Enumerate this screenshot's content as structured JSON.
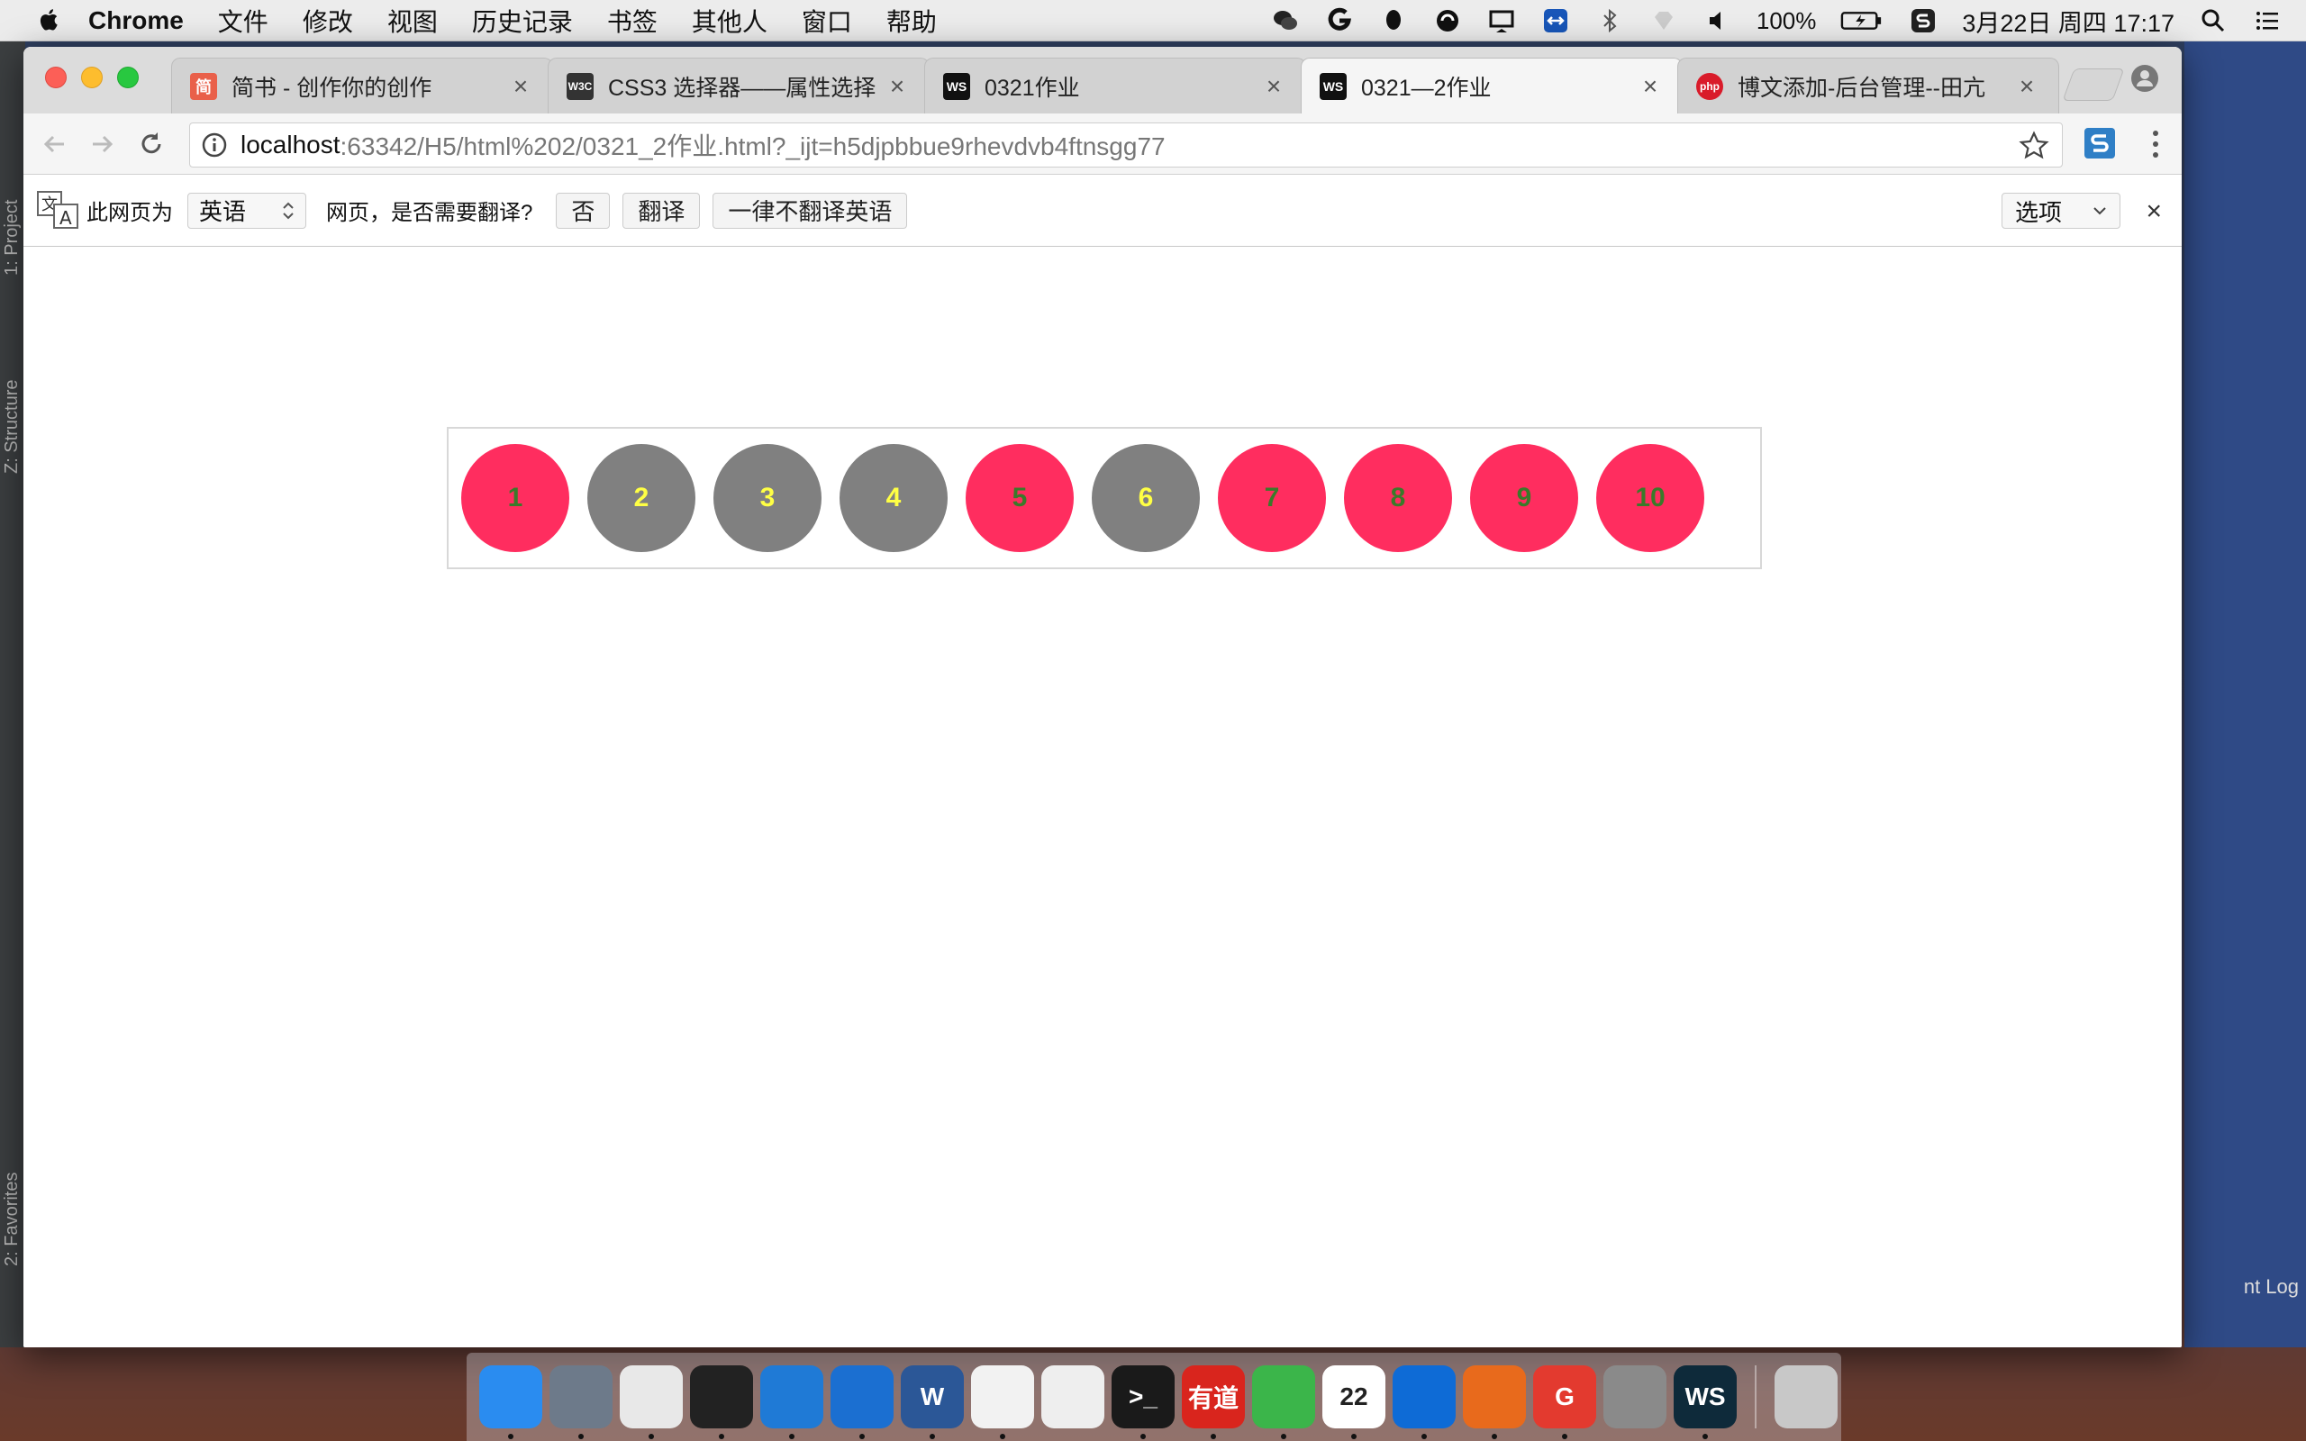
{
  "menubar": {
    "app_name": "Chrome",
    "menus": [
      "文件",
      "修改",
      "视图",
      "历史记录",
      "书签",
      "其他人",
      "窗口",
      "帮助"
    ],
    "battery": "100%",
    "datetime": "3月22日 周四  17:17"
  },
  "tabs": [
    {
      "title": "简书 - 创作你的创作",
      "favicon_text": "简",
      "favicon_color": "#e9604a"
    },
    {
      "title": "CSS3 选择器——属性选择器",
      "favicon_text": "W3C",
      "favicon_color": "#333333"
    },
    {
      "title": "0321作业",
      "favicon_text": "WS",
      "favicon_color": "#111111"
    },
    {
      "title": "0321—2作业",
      "favicon_text": "WS",
      "favicon_color": "#111111"
    },
    {
      "title": "博文添加-后台管理--田亢",
      "favicon_text": "php",
      "favicon_color": "#d91b2a"
    }
  ],
  "address": {
    "host": "localhost",
    "path": ":63342/H5/html%202/0321_2作业.html?_ijt=h5djpbbue9rhevdvb4ftnsgg77"
  },
  "translate": {
    "prefix": "此网页为",
    "language": "英语",
    "question": "网页，是否需要翻译?",
    "no_label": "否",
    "translate_label": "翻译",
    "never_label": "一律不翻译英语",
    "options_label": "选项",
    "close_glyph": "×"
  },
  "ide": {
    "left_labels": [
      "1: Project",
      "Z: Structure",
      "2: Favorites"
    ],
    "right_label": "nt Log"
  },
  "balls": [
    {
      "label": "1",
      "bg": "#ff2d5f",
      "fg": "#3a7a2a"
    },
    {
      "label": "2",
      "bg": "#808080",
      "fg": "#ffff44"
    },
    {
      "label": "3",
      "bg": "#808080",
      "fg": "#ffff44"
    },
    {
      "label": "4",
      "bg": "#808080",
      "fg": "#ffff44"
    },
    {
      "label": "5",
      "bg": "#ff2d5f",
      "fg": "#3a7a2a"
    },
    {
      "label": "6",
      "bg": "#808080",
      "fg": "#ffff44"
    },
    {
      "label": "7",
      "bg": "#ff2d5f",
      "fg": "#3a7a2a"
    },
    {
      "label": "8",
      "bg": "#ff2d5f",
      "fg": "#3a7a2a"
    },
    {
      "label": "9",
      "bg": "#ff2d5f",
      "fg": "#3a7a2a"
    },
    {
      "label": "10",
      "bg": "#ff2d5f",
      "fg": "#3a7a2a"
    }
  ],
  "dock": [
    {
      "name": "finder",
      "color": "#2a8cf0",
      "text": ""
    },
    {
      "name": "launchpad",
      "color": "#6d7a8a",
      "text": ""
    },
    {
      "name": "chrome",
      "color": "#e8e8e8",
      "text": ""
    },
    {
      "name": "qq",
      "color": "#222222",
      "text": ""
    },
    {
      "name": "browser",
      "color": "#1f7ad6",
      "text": ""
    },
    {
      "name": "xcode",
      "color": "#1b6fd1",
      "text": ""
    },
    {
      "name": "word",
      "color": "#2b5797",
      "text": "W"
    },
    {
      "name": "c-app",
      "color": "#f2f2f2",
      "text": ""
    },
    {
      "name": "textedit",
      "color": "#eeeeee",
      "text": ""
    },
    {
      "name": "terminal",
      "color": "#1a1a1a",
      "text": ">_"
    },
    {
      "name": "youdao",
      "color": "#d9251d",
      "text": "有道"
    },
    {
      "name": "wechat",
      "color": "#3bb54a",
      "text": ""
    },
    {
      "name": "calendar",
      "color": "#ffffff",
      "text": "22"
    },
    {
      "name": "teamviewer",
      "color": "#0e6bd6",
      "text": ""
    },
    {
      "name": "firefox",
      "color": "#e86a1c",
      "text": ""
    },
    {
      "name": "gitapp",
      "color": "#e33a2f",
      "text": "G"
    },
    {
      "name": "keychain",
      "color": "#8a8a8a",
      "text": ""
    },
    {
      "name": "webstorm",
      "color": "#0e2a3a",
      "text": "WS"
    },
    {
      "name": "trash",
      "color": "#c8c8c8",
      "text": ""
    }
  ]
}
